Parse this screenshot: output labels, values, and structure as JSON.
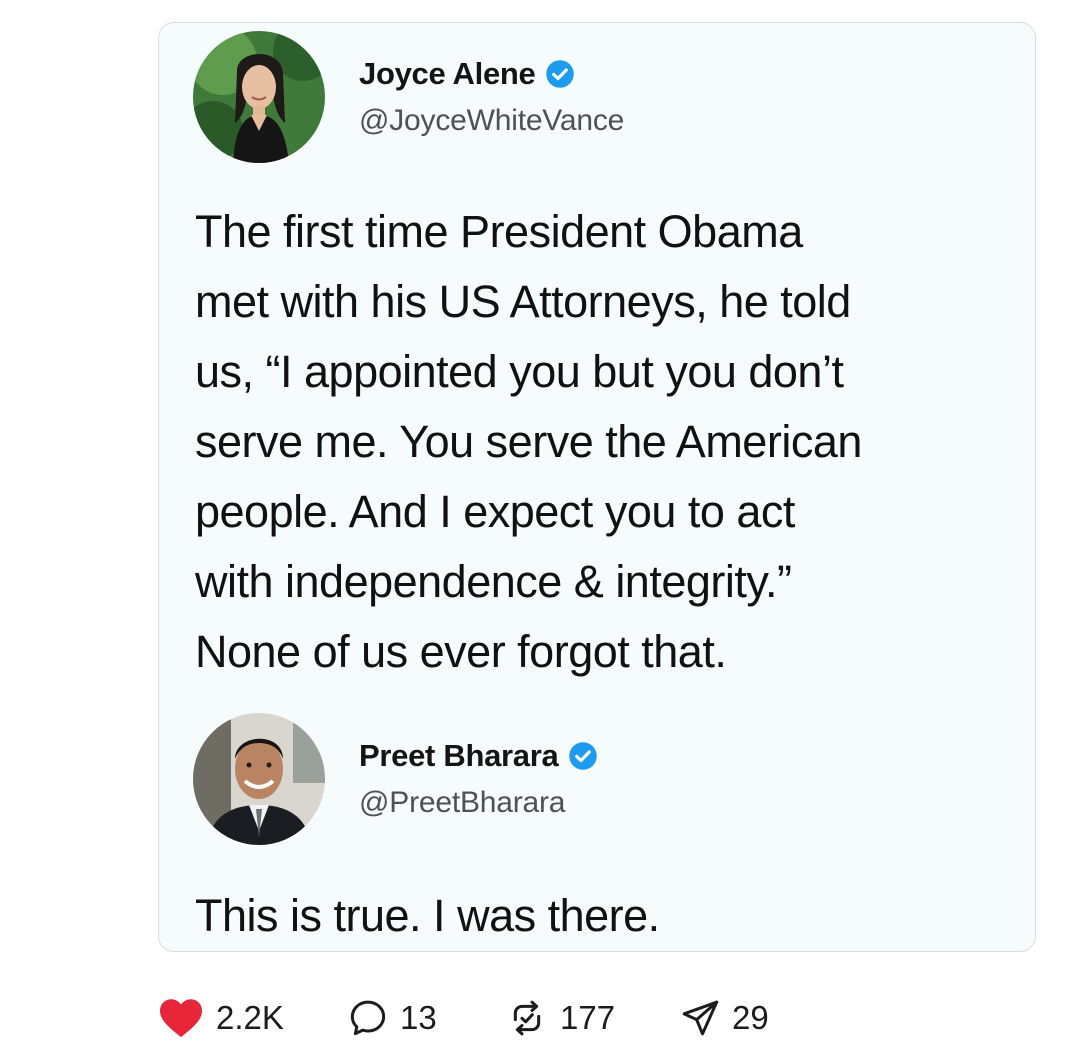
{
  "tweet1": {
    "display_name": "Joyce Alene",
    "handle": "@JoyceWhiteVance",
    "text": "The first time President Obama\nmet with his US Attorneys, he told\nus, “I appointed you but you don’t\nserve me. You serve the American\npeople. And I expect you to act\nwith independence & integrity.”\nNone of us ever forgot that."
  },
  "tweet2": {
    "display_name": "Preet Bharara",
    "handle": "@PreetBharara",
    "text": "This is true. I was there."
  },
  "stats": {
    "likes": "2.2K",
    "replies": "13",
    "reposts": "177",
    "shares": "29"
  },
  "icons": {
    "like": "heart-icon",
    "reply": "reply-bubble-icon",
    "repost": "repost-icon",
    "share": "send-icon",
    "verified": "verified-badge-icon"
  },
  "colors": {
    "heart": "#e8263a",
    "verified": "#1d9bf0",
    "card_background": "#f6fbfb"
  }
}
